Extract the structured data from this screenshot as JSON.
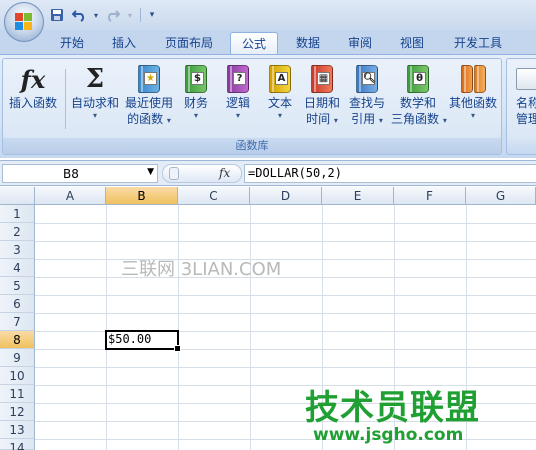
{
  "qat": {
    "undo_icon": "undo-icon",
    "redo_icon": "redo-icon",
    "save_icon": "save-icon"
  },
  "tabs": [
    "开始",
    "插入",
    "页面布局",
    "公式",
    "数据",
    "审阅",
    "视图",
    "开发工具"
  ],
  "active_tab": "公式",
  "ribbon": {
    "insert_function": "插入函数",
    "autosum": "自动求和",
    "recent_1": "最近使用",
    "recent_2": "的函数",
    "financial": "财务",
    "logical": "逻辑",
    "text": "文本",
    "datetime_1": "日期和",
    "datetime_2": "时间",
    "lookup_1": "查找与",
    "lookup_2": "引用",
    "math_1": "数学和",
    "math_2": "三角函数",
    "more": "其他函数",
    "name_mgr_1": "名称",
    "name_mgr_2": "管理",
    "group_label": "函数库",
    "dropdown_arrow": "▾"
  },
  "formula_bar": {
    "name_box": "B8",
    "fx_label": "fx",
    "formula": "=DOLLAR(50,2)"
  },
  "columns": [
    "A",
    "B",
    "C",
    "D",
    "E",
    "F",
    "G"
  ],
  "rows": [
    "1",
    "2",
    "3",
    "4",
    "5",
    "6",
    "7",
    "8",
    "9",
    "10",
    "11",
    "12",
    "13",
    "14"
  ],
  "cells": {
    "B8": "$50.00"
  },
  "watermarks": {
    "w1": "三联网 3LIAN.COM",
    "w2": "技术员联盟",
    "w3": "www.jsgho.com"
  },
  "colors": {
    "selected_header": "#f1c15f",
    "watermark_green": "#20a033"
  }
}
